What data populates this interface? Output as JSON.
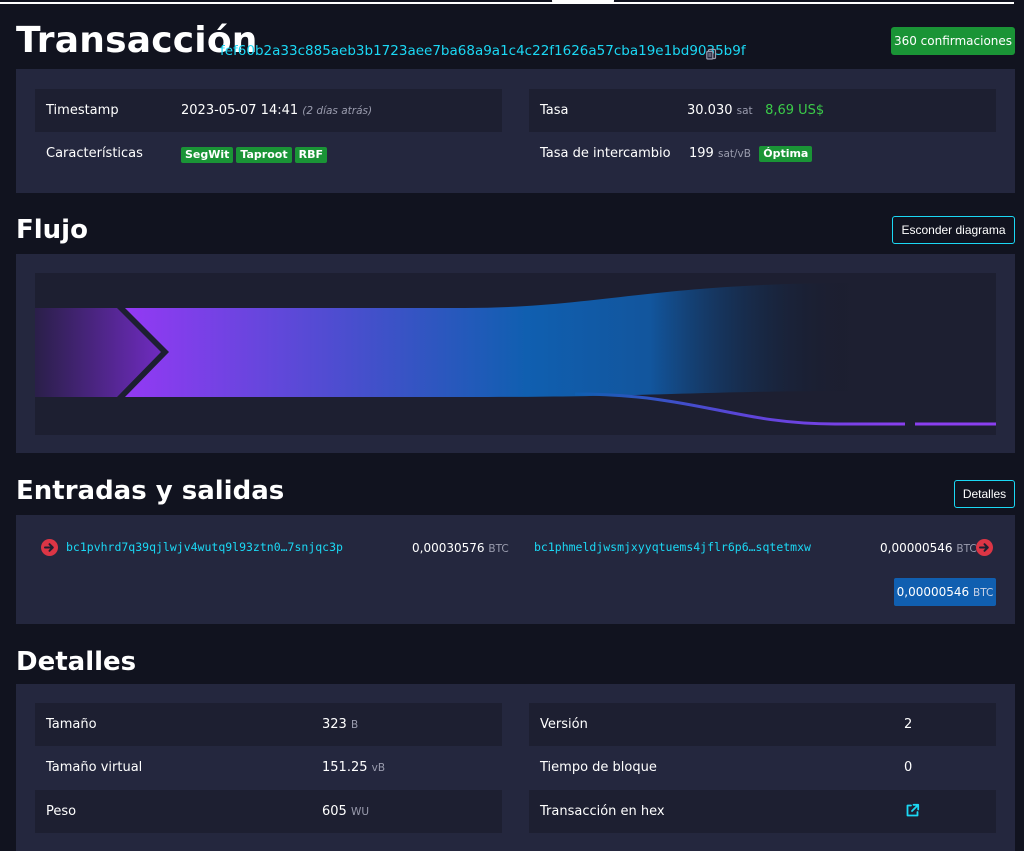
{
  "header": {
    "title": "Transacción",
    "txid": "fef60b2a33c885aeb3b1723aee7ba68a9a1c4c22f1626a57cba19e1bd9035b9f",
    "confirmations": "360 confirmaciones"
  },
  "summary": {
    "timestamp_label": "Timestamp",
    "timestamp_value": "2023-05-07 14:41",
    "timestamp_ago": "(2 días atrás)",
    "features_label": "Características",
    "features": [
      "SegWit",
      "Taproot",
      "RBF"
    ],
    "fee_label": "Tasa",
    "fee_sat": "30.030",
    "fee_unit": "sat",
    "fee_usd": "8,69 US$",
    "rate_label": "Tasa de intercambio",
    "rate_value": "199",
    "rate_unit": "sat/vB",
    "rate_badge": "Óptima"
  },
  "flow": {
    "title": "Flujo",
    "hide_button": "Esconder diagrama",
    "colors": {
      "input": "#9339f4",
      "output": "#105fb0"
    }
  },
  "io": {
    "title": "Entradas y salidas",
    "details_button": "Detalles",
    "input_address": "bc1pvhrd7q39qjlwjv4wutq9l93ztn0…7snjqc3p",
    "input_amount": "0,00030576",
    "input_unit": "BTC",
    "output_address": "bc1phmeldjwsmjxyyqtuems4jflr6p6…sqtetmxw",
    "output_amount": "0,00000546",
    "output_unit": "BTC",
    "total_amount": "0,00000546",
    "total_unit": "BTC"
  },
  "details": {
    "title": "Detalles",
    "size_label": "Tamaño",
    "size_value": "323",
    "size_unit": "B",
    "vsize_label": "Tamaño virtual",
    "vsize_value": "151.25",
    "vsize_unit": "vB",
    "weight_label": "Peso",
    "weight_value": "605",
    "weight_unit": "WU",
    "version_label": "Versión",
    "version_value": "2",
    "locktime_label": "Tiempo de bloque",
    "locktime_value": "0",
    "hex_label": "Transacción en hex",
    "hex_icon": "external-link-icon"
  },
  "colors": {
    "accent": "#1bd8f4",
    "success": "#1a9436",
    "danger": "#dc3545",
    "card": "#24273e",
    "cell": "#1d1f31",
    "background": "#11131f"
  }
}
